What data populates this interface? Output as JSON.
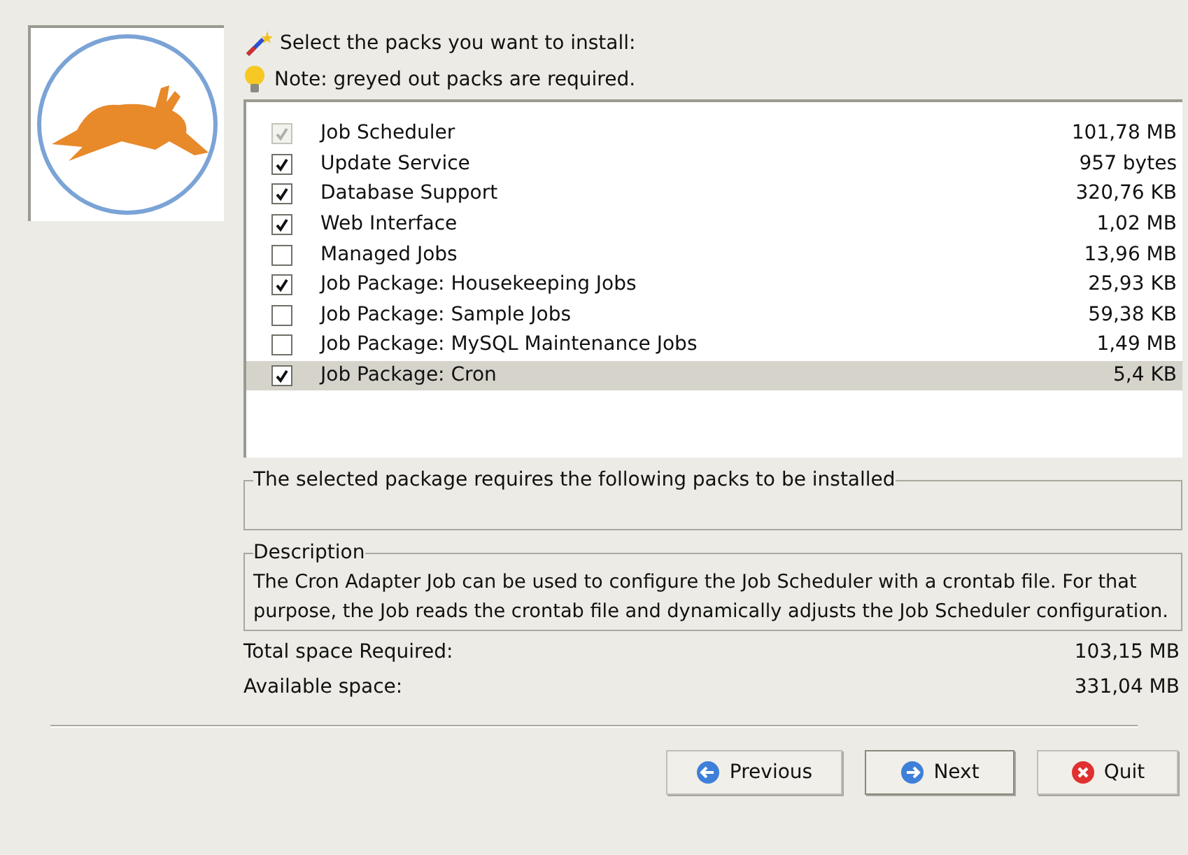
{
  "header": {
    "title": "Select the packs you want to install:",
    "note": "Note: greyed out packs are required."
  },
  "packs": [
    {
      "name": "Job Scheduler",
      "size": "101,78 MB",
      "checked": true,
      "disabled": true,
      "selected": false
    },
    {
      "name": "Update Service",
      "size": "957 bytes",
      "checked": true,
      "disabled": false,
      "selected": false
    },
    {
      "name": "Database Support",
      "size": "320,76 KB",
      "checked": true,
      "disabled": false,
      "selected": false
    },
    {
      "name": "Web Interface",
      "size": "1,02 MB",
      "checked": true,
      "disabled": false,
      "selected": false
    },
    {
      "name": "Managed Jobs",
      "size": "13,96 MB",
      "checked": false,
      "disabled": false,
      "selected": false
    },
    {
      "name": "Job Package: Housekeeping Jobs",
      "size": "25,93 KB",
      "checked": true,
      "disabled": false,
      "selected": false
    },
    {
      "name": "Job Package: Sample Jobs",
      "size": "59,38 KB",
      "checked": false,
      "disabled": false,
      "selected": false
    },
    {
      "name": "Job Package: MySQL Maintenance Jobs",
      "size": "1,49 MB",
      "checked": false,
      "disabled": false,
      "selected": false
    },
    {
      "name": "Job Package: Cron",
      "size": "5,4 KB",
      "checked": true,
      "disabled": false,
      "selected": true
    }
  ],
  "requires": {
    "legend": "The selected package requires the following packs to be installed"
  },
  "description": {
    "legend": "Description",
    "text": "The Cron Adapter Job can be used to configure the Job Scheduler with a crontab file. For that purpose, the Job reads the crontab file and dynamically adjusts the Job Scheduler configuration."
  },
  "space": [
    {
      "label": "Total space Required:",
      "value": "103,15 MB"
    },
    {
      "label": "Available space:",
      "value": "331,04 MB"
    }
  ],
  "buttons": [
    {
      "label": "Previous",
      "kind": "previous"
    },
    {
      "label": "Next",
      "kind": "next"
    },
    {
      "label": "Quit",
      "kind": "quit"
    }
  ]
}
